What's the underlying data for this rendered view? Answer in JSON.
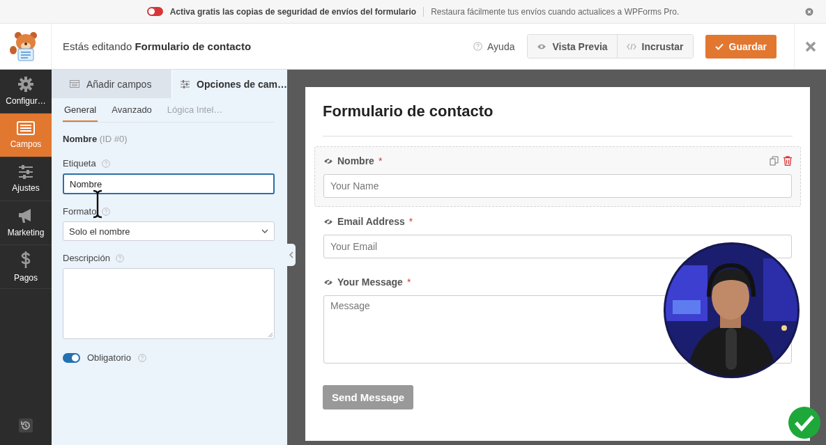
{
  "notice": {
    "on": false,
    "message": "Activa gratis las copias de seguridad de envíos del formulario",
    "detail": "Restaura fácilmente tus envíos cuando actualices a WPForms Pro."
  },
  "header": {
    "title": "Estás editando **Formulario de contacto**",
    "help": "Ayuda",
    "buttons": [
      {
        "label": "Vista Previa"
      },
      {
        "label": "Incrustar"
      }
    ],
    "save": "Guardar"
  },
  "sidebar": {
    "items": [
      {
        "label": "Configur…",
        "selected": false
      },
      {
        "label": "Campos",
        "selected": true
      },
      {
        "label": "Ajustes",
        "selected": false
      },
      {
        "label": "Marketing",
        "selected": false
      },
      {
        "label": "Pagos",
        "selected": false
      }
    ]
  },
  "panel": {
    "tabs": [
      {
        "label": "Añadir campos",
        "selected": false
      },
      {
        "label": "Opciones de cam…",
        "selected": true
      }
    ],
    "subtabs": [
      {
        "label": "General",
        "selected": true,
        "disabled": false
      },
      {
        "label": "Avanzado",
        "selected": false,
        "disabled": false
      },
      {
        "label": "Lógica Intel…",
        "selected": false,
        "disabled": true
      }
    ],
    "field_title": "Nombre",
    "field_id": "(ID #0)",
    "label_field": {
      "label": "Etiqueta",
      "value": "Nombre"
    },
    "format_field": {
      "label": "Formato",
      "value": "Solo el nombre"
    },
    "description_field": {
      "label": "Descripción"
    },
    "required": {
      "label": "Obligatorio",
      "on": true
    }
  },
  "preview": {
    "title": "Formulario de contacto",
    "fields": [
      {
        "kind": "input",
        "label": "Nombre",
        "required": true,
        "placeholder": "Your Name",
        "selected": true
      },
      {
        "kind": "input",
        "label": "Email Address",
        "required": true,
        "placeholder": "Your Email",
        "selected": false
      },
      {
        "kind": "textarea",
        "label": "Your Message",
        "required": true,
        "placeholder": "Message",
        "selected": false
      }
    ],
    "required_mark": "*",
    "submit": "Send Message"
  }
}
